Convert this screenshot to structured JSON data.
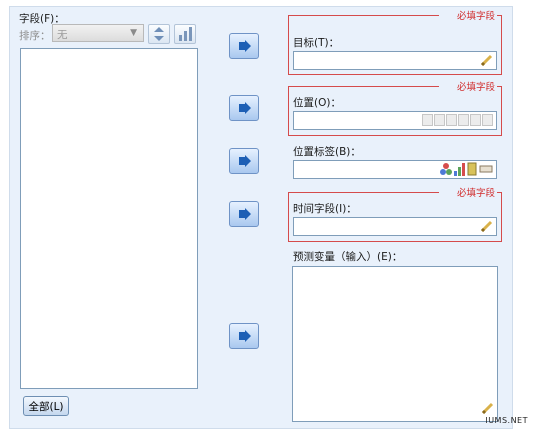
{
  "fields": {
    "label": "字段(F)：",
    "sort_label": "排序：",
    "sort_value": "无",
    "sort_icon": "up-down-sort-icon",
    "sort_order_icon": "sort-order-icon",
    "all_button": "全部(L)"
  },
  "arrow_icon": "move-right-arrow-icon",
  "target": {
    "required": "必填字段",
    "label": "目标(T)：",
    "value": ""
  },
  "location": {
    "required": "必填字段",
    "label": "位置(O)：",
    "value": "",
    "icons": [
      "point-icon",
      "line-icon",
      "polygon-icon",
      "circle-icon",
      "grid-icon",
      "multi-icon"
    ]
  },
  "location_label": {
    "label": "位置标签(B)：",
    "value": "",
    "icons": [
      "nominal-icon",
      "ordinal-icon",
      "scale-icon",
      "string-icon"
    ]
  },
  "time_field": {
    "required": "必填字段",
    "label": "时间字段(I)：",
    "value": ""
  },
  "predictors": {
    "label": "预测变量（输入）(E)："
  },
  "watermark": "IUMS.NET"
}
